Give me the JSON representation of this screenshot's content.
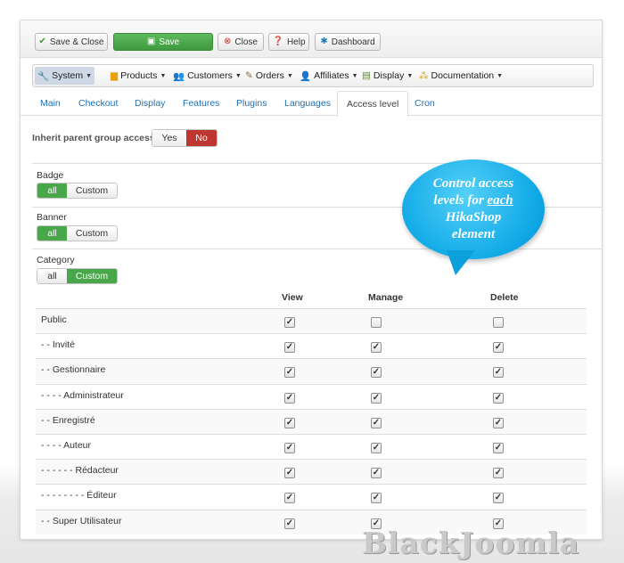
{
  "toolbar": {
    "save_close": "Save & Close",
    "save": "Save",
    "close": "Close",
    "help": "Help",
    "dashboard": "Dashboard"
  },
  "menu": [
    "System",
    "Products",
    "Customers",
    "Orders",
    "Affiliates",
    "Display",
    "Documentation"
  ],
  "tabs": [
    "Main",
    "Checkout",
    "Display",
    "Features",
    "Plugins",
    "Languages",
    "Access level",
    "Cron"
  ],
  "inherit": {
    "label": "Inherit parent group access",
    "yes": "Yes",
    "no": "No",
    "selected": "No"
  },
  "sections": {
    "badge": {
      "label": "Badge",
      "all": "all",
      "custom": "Custom",
      "selected": "all"
    },
    "banner": {
      "label": "Banner",
      "all": "all",
      "custom": "Custom",
      "selected": "all"
    },
    "category": {
      "label": "Category",
      "all": "all",
      "custom": "Custom",
      "selected": "Custom"
    }
  },
  "callout": {
    "line1": "Control access",
    "line2a": "levels for ",
    "line2b": "each",
    "line3": "HikaShop",
    "line4": "element"
  },
  "table": {
    "headers": {
      "view": "View",
      "manage": "Manage",
      "delete": "Delete"
    },
    "rows": [
      {
        "name": "Public",
        "view": true,
        "manage": false,
        "delete": false
      },
      {
        "name": "- - Invité",
        "view": true,
        "manage": true,
        "delete": true
      },
      {
        "name": "- - Gestionnaire",
        "view": true,
        "manage": true,
        "delete": true
      },
      {
        "name": "- - - - Administrateur",
        "view": true,
        "manage": true,
        "delete": true
      },
      {
        "name": "- - Enregistré",
        "view": true,
        "manage": true,
        "delete": true
      },
      {
        "name": "- - - - Auteur",
        "view": true,
        "manage": true,
        "delete": true
      },
      {
        "name": "- - - - - - Rédacteur",
        "view": true,
        "manage": true,
        "delete": true
      },
      {
        "name": "- - - - - - - - Éditeur",
        "view": true,
        "manage": true,
        "delete": true
      },
      {
        "name": "- - Super Utilisateur",
        "view": true,
        "manage": true,
        "delete": true
      }
    ]
  },
  "watermark": "BlackJoomla",
  "colors": {
    "save_green": "#4aa64a",
    "no_red": "#bd362f",
    "link_blue": "#1f6fb3",
    "bubble_blue": "#0ea8e6"
  }
}
